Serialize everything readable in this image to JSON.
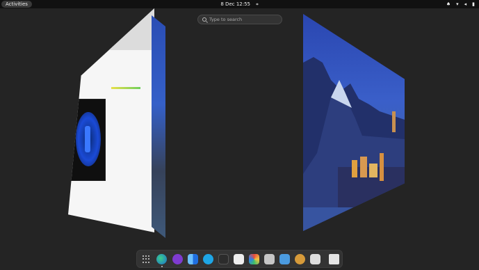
{
  "topbar": {
    "activities_label": "Activities",
    "datetime": "8 Dec  12:55"
  },
  "search": {
    "placeholder": "Type to search"
  },
  "dock": {
    "apps": [
      {
        "name": "show-apps",
        "icon": "grid-icon"
      },
      {
        "name": "edge",
        "icon": "edge-icon"
      },
      {
        "name": "tor",
        "icon": "tor-icon"
      },
      {
        "name": "finder",
        "icon": "finder-icon"
      },
      {
        "name": "skype",
        "icon": "skype-icon"
      },
      {
        "name": "terminal",
        "icon": "terminal-icon"
      },
      {
        "name": "text-editor",
        "icon": "text-editor-icon"
      },
      {
        "name": "photos",
        "icon": "photos-icon"
      },
      {
        "name": "archive",
        "icon": "archive-icon"
      },
      {
        "name": "reader",
        "icon": "reader-icon"
      },
      {
        "name": "burger-app",
        "icon": "burger-icon"
      },
      {
        "name": "screenshot",
        "icon": "screenshot-icon"
      },
      {
        "name": "trash",
        "icon": "trash-icon"
      }
    ]
  },
  "colors": {
    "panel": "#111111",
    "background": "#242424",
    "dock": "#333333",
    "wallpaper_blue": "#3560c8"
  }
}
